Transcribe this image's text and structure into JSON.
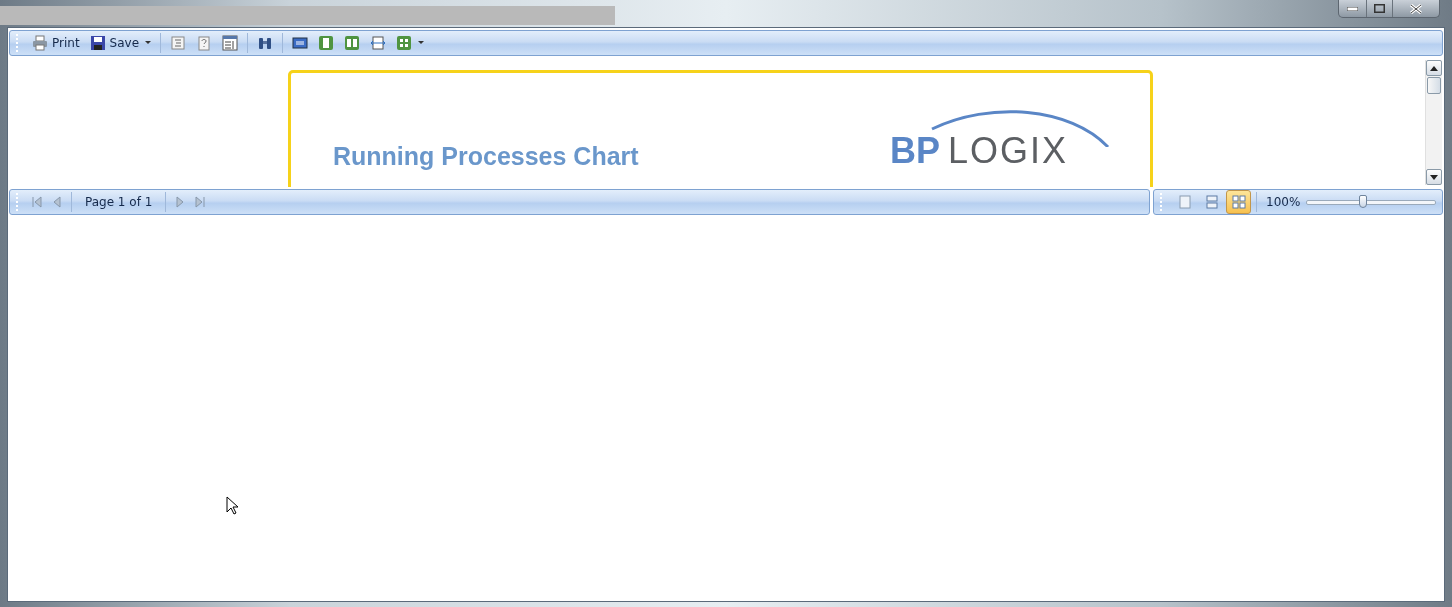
{
  "toolbar": {
    "items": [
      {
        "kind": "button",
        "label": "Print"
      },
      {
        "kind": "button",
        "label": "Save",
        "dropdown": true
      },
      {
        "kind": "separator"
      },
      {
        "kind": "button"
      },
      {
        "kind": "button"
      },
      {
        "kind": "button"
      },
      {
        "kind": "separator"
      },
      {
        "kind": "button"
      },
      {
        "kind": "separator"
      },
      {
        "kind": "button"
      },
      {
        "kind": "button"
      },
      {
        "kind": "button"
      },
      {
        "kind": "button"
      },
      {
        "kind": "button",
        "dropdown": true
      }
    ]
  },
  "report": {
    "title": "Running Processes Chart",
    "logo": {
      "part_1": "BP",
      "part_2": "LOGIX"
    }
  },
  "navigation": {
    "page_label": "Page 1 of 1"
  },
  "view_modes": [
    {
      "selected": false
    },
    {
      "selected": false
    },
    {
      "selected": true
    }
  ],
  "zoom": {
    "reading": "100%",
    "level": 0.44
  }
}
